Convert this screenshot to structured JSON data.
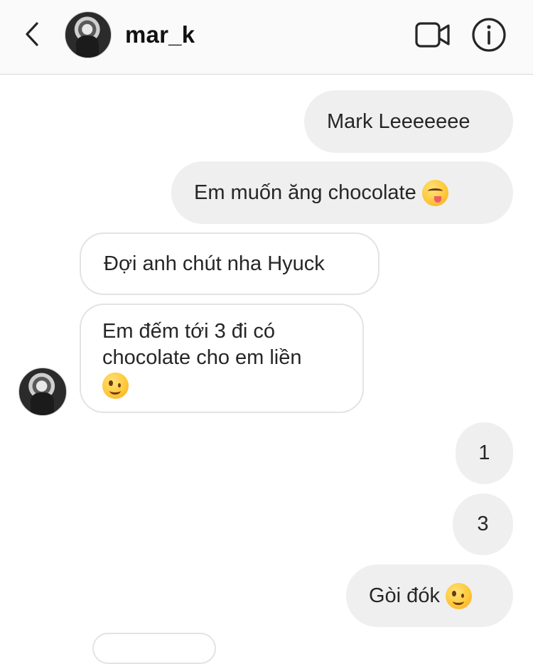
{
  "header": {
    "username": "mar_k",
    "back_icon": "chevron-left-icon",
    "video_icon": "video-camera-icon",
    "info_icon": "info-icon"
  },
  "messages": [
    {
      "direction": "outgoing",
      "text": "Mark Leeeeeee"
    },
    {
      "direction": "outgoing",
      "text": "Em muốn ăng chocolate",
      "emoji": "face-savoring-food"
    },
    {
      "direction": "incoming",
      "text": "Đợi anh chút nha Hyuck"
    },
    {
      "direction": "incoming",
      "text": "Em đếm tới 3 đi có\nchocolate cho em liền",
      "emoji": "winking-face"
    },
    {
      "direction": "outgoing",
      "text": "1"
    },
    {
      "direction": "outgoing",
      "text": "3"
    },
    {
      "direction": "outgoing",
      "text": "Gòi đók",
      "emoji": "winking-face"
    }
  ],
  "colors": {
    "outgoing_bubble": "#efefef",
    "incoming_border": "#e3e3e3",
    "header_bg": "#fafafa",
    "text": "#262626"
  }
}
